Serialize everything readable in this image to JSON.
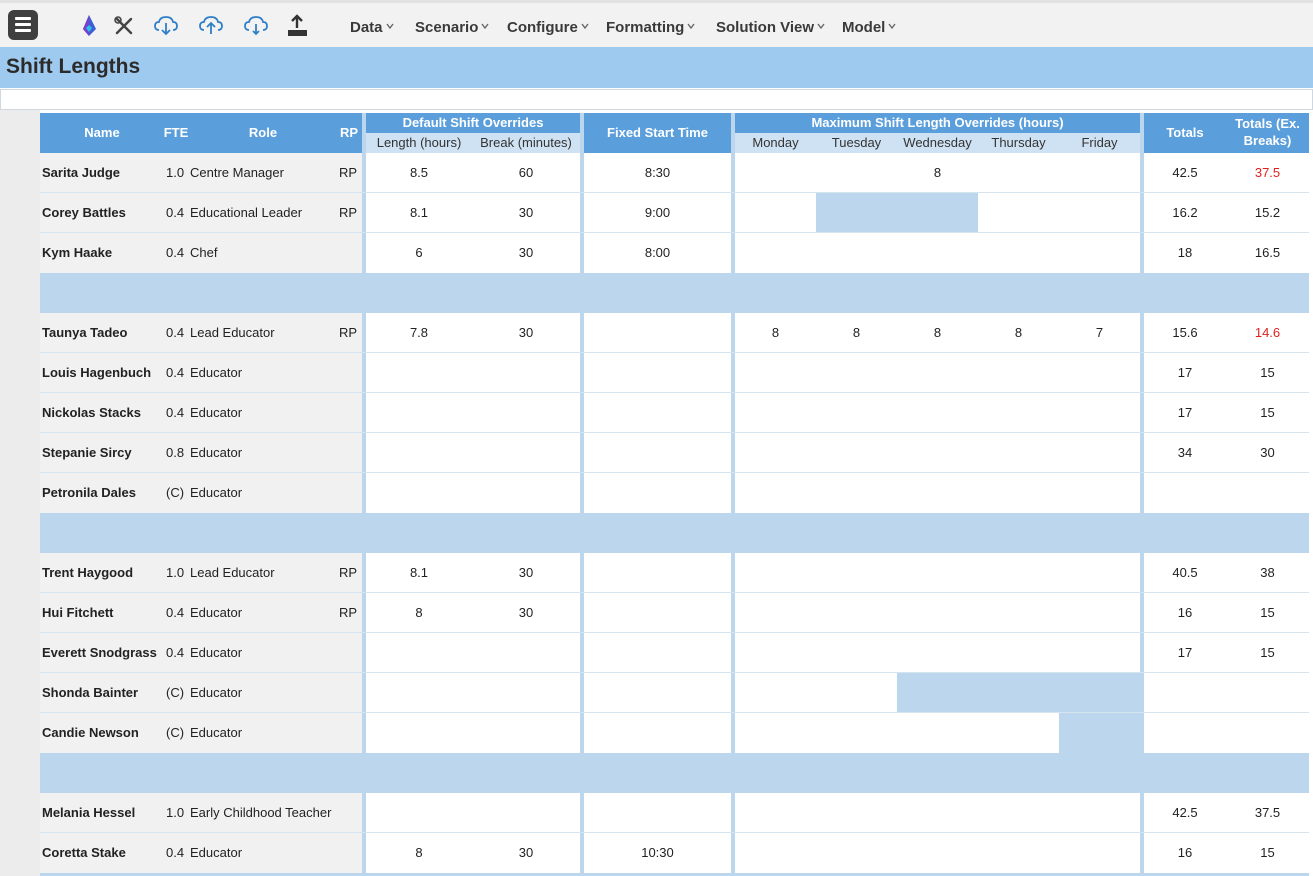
{
  "toolbar": {
    "menus": [
      "Data",
      "Scenario",
      "Configure",
      "Formatting",
      "Solution View",
      "Model"
    ],
    "icons": [
      "hamburger-menu-icon",
      "app-logo-icon",
      "tools-icon",
      "cloud-download-icon",
      "cloud-upload-icon",
      "cloud-sync-icon",
      "export-upload-icon"
    ]
  },
  "page": {
    "title": "Shift Lengths"
  },
  "headers": {
    "name": "Name",
    "fte": "FTE",
    "role": "Role",
    "rp": "RP",
    "default_group": "Default Shift Overrides",
    "length": "Length (hours)",
    "break": "Break (minutes)",
    "fixed_start": "Fixed Start Time",
    "max_group": "Maximum Shift Length Overrides (hours)",
    "days": [
      "Monday",
      "Tuesday",
      "Wednesday",
      "Thursday",
      "Friday"
    ],
    "totals": "Totals",
    "totals_ex_1": "Totals (Ex.",
    "totals_ex_2": "Breaks)"
  },
  "rows": [
    {
      "name": "Sarita Judge",
      "fte": "1.0",
      "role": "Centre Manager",
      "rp": "RP",
      "length": "8.5",
      "break": "60",
      "start": "8:30",
      "days": [
        "",
        "",
        "8",
        "",
        ""
      ],
      "total": "42.5",
      "total_ex": "37.5",
      "total_ex_red": true
    },
    {
      "name": "Corey Battles",
      "fte": "0.4",
      "role": "Educational Leader",
      "rp": "RP",
      "length": "8.1",
      "break": "30",
      "start": "9:00",
      "days": [
        "",
        "",
        "",
        "",
        ""
      ],
      "total": "16.2",
      "total_ex": "15.2"
    },
    {
      "name": "Kym Haake",
      "fte": "0.4",
      "role": "Chef",
      "rp": "",
      "length": "6",
      "break": "30",
      "start": "8:00",
      "days": [
        "",
        "",
        "",
        "",
        ""
      ],
      "total": "18",
      "total_ex": "16.5"
    },
    {
      "spacer": true
    },
    {
      "name": "Taunya Tadeo",
      "fte": "0.4",
      "role": "Lead Educator",
      "rp": "RP",
      "length": "7.8",
      "break": "30",
      "start": "",
      "days": [
        "8",
        "8",
        "8",
        "8",
        "7"
      ],
      "total": "15.6",
      "total_ex": "14.6",
      "total_ex_red": true
    },
    {
      "name": "Louis Hagenbuch",
      "fte": "0.4",
      "role": "Educator",
      "rp": "",
      "length": "",
      "break": "",
      "start": "",
      "days": [
        "",
        "",
        "",
        "",
        ""
      ],
      "total": "17",
      "total_ex": "15"
    },
    {
      "name": "Nickolas Stacks",
      "fte": "0.4",
      "role": "Educator",
      "rp": "",
      "length": "",
      "break": "",
      "start": "",
      "days": [
        "",
        "",
        "",
        "",
        ""
      ],
      "total": "17",
      "total_ex": "15"
    },
    {
      "name": "Stepanie Sircy",
      "fte": "0.8",
      "role": "Educator",
      "rp": "",
      "length": "",
      "break": "",
      "start": "",
      "days": [
        "",
        "",
        "",
        "",
        ""
      ],
      "total": "34",
      "total_ex": "30"
    },
    {
      "name": "Petronila Dales",
      "fte": "(C)",
      "role": "Educator",
      "rp": "",
      "length": "",
      "break": "",
      "start": "",
      "days": [
        "",
        "",
        "",
        "",
        ""
      ],
      "total": "",
      "total_ex": ""
    },
    {
      "spacer": true
    },
    {
      "name": "Trent Haygood",
      "fte": "1.0",
      "role": "Lead Educator",
      "rp": "RP",
      "length": "8.1",
      "break": "30",
      "start": "",
      "days": [
        "",
        "",
        "",
        "",
        ""
      ],
      "total": "40.5",
      "total_ex": "38"
    },
    {
      "name": "Hui Fitchett",
      "fte": "0.4",
      "role": "Educator",
      "rp": "RP",
      "length": "8",
      "break": "30",
      "start": "",
      "days": [
        "",
        "",
        "",
        "",
        ""
      ],
      "total": "16",
      "total_ex": "15"
    },
    {
      "name": "Everett Snodgrass",
      "fte": "0.4",
      "role": "Educator",
      "rp": "",
      "length": "",
      "break": "",
      "start": "",
      "days": [
        "",
        "",
        "",
        "",
        ""
      ],
      "total": "17",
      "total_ex": "15"
    },
    {
      "name": "Shonda Bainter",
      "fte": "(C)",
      "role": "Educator",
      "rp": "",
      "length": "",
      "break": "",
      "start": "",
      "days": [
        "",
        "",
        "",
        "",
        ""
      ],
      "total": "",
      "total_ex": ""
    },
    {
      "name": "Candie Newson",
      "fte": "(C)",
      "role": "Educator",
      "rp": "",
      "length": "",
      "break": "",
      "start": "",
      "days": [
        "",
        "",
        "",
        "",
        ""
      ],
      "total": "",
      "total_ex": ""
    },
    {
      "spacer": true
    },
    {
      "name": "Melania Hessel",
      "fte": "1.0",
      "role": "Early Childhood Teacher",
      "rp": "",
      "length": "",
      "break": "",
      "start": "",
      "days": [
        "",
        "",
        "",
        "",
        ""
      ],
      "total": "42.5",
      "total_ex": "37.5"
    },
    {
      "name": "Coretta Stake",
      "fte": "0.4",
      "role": "Educator",
      "rp": "",
      "length": "8",
      "break": "30",
      "start": "10:30",
      "days": [
        "",
        "",
        "",
        "",
        ""
      ],
      "total": "16",
      "total_ex": "15"
    }
  ],
  "colors": {
    "header": "#5a9edb",
    "title_bar": "#9fcaef",
    "spacer": "#bcd6ee",
    "warning": "#e02020"
  }
}
